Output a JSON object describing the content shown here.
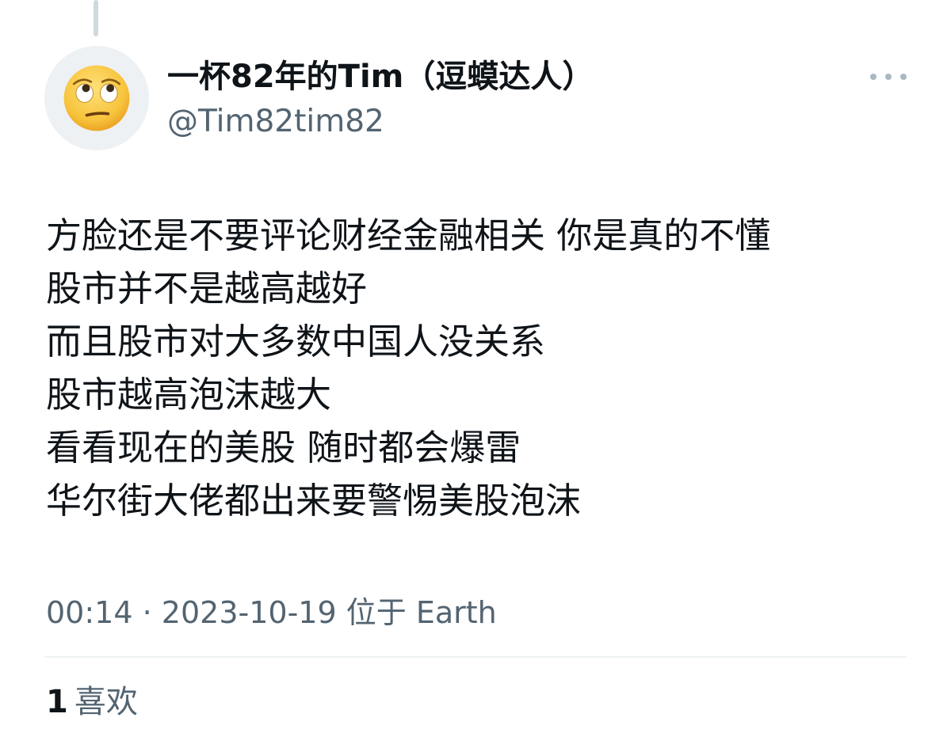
{
  "tweet": {
    "author": {
      "display_name": "一杯82年的Tim（逗蟆达人）",
      "handle": "@Tim82tim82",
      "avatar_icon": "face-with-rolling-eyes-emoji"
    },
    "more_icon": "more-options-icon",
    "text_lines": [
      "方脸还是不要评论财经金融相关 你是真的不懂",
      "股市并不是越高越好",
      "而且股市对大多数中国人没关系",
      "股市越高泡沫越大",
      "看看现在的美股 随时都会爆雷",
      "华尔街大佬都出来要警惕美股泡沫"
    ],
    "meta": {
      "time": "00:14",
      "separator": "·",
      "date": "2023-10-19",
      "location": "位于 Earth"
    },
    "likes": {
      "count": "1",
      "label": "喜欢"
    }
  },
  "colors": {
    "text_primary": "#0f1419",
    "text_secondary": "#536471",
    "divider": "#eff3f4",
    "thread_line": "#cfd9de",
    "emoji_face": "#f7c33b"
  }
}
